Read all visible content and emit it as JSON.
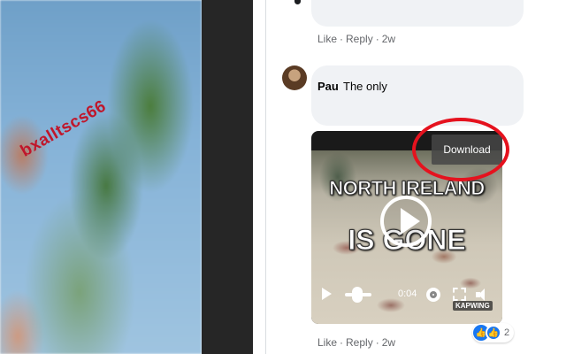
{
  "photo": {
    "watermark": "bxalltscs66"
  },
  "top_comment": {
    "actions": {
      "like": "Like",
      "reply": "Reply",
      "separator": "·",
      "time": "2w"
    }
  },
  "comment": {
    "author": "Pau",
    "text": "The only",
    "actions": {
      "like": "Like",
      "reply": "Reply",
      "separator": "·",
      "time": "2w"
    }
  },
  "video": {
    "title_line1": "NORTH IRELAND",
    "title_line2": "IS GONE",
    "time": "0:04",
    "badge": "KAPWING"
  },
  "overlay": {
    "download_label": "Download",
    "highlight_color": "#e5121e"
  },
  "reactions": {
    "count": "2",
    "types": [
      "like-icon",
      "love-icon"
    ]
  },
  "colors": {
    "link": "#65676b",
    "bubble": "#f0f2f5",
    "accent": "#1877f2"
  }
}
